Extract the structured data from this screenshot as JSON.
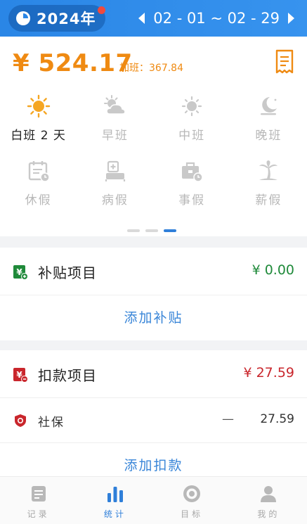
{
  "header": {
    "year": "2024年",
    "date_range": "02 - 01 ~ 02 - 29"
  },
  "summary": {
    "amount": "¥ 524.17",
    "overtime": "加班：367.84",
    "shifts": [
      {
        "label": "白班 2 天",
        "icon": "sun-icon",
        "active": true
      },
      {
        "label": "早班",
        "icon": "cloud-sun-icon",
        "active": false
      },
      {
        "label": "中班",
        "icon": "sun-small-icon",
        "active": false
      },
      {
        "label": "晚班",
        "icon": "moon-icon",
        "active": false
      },
      {
        "label": "休假",
        "icon": "calendar-icon",
        "active": false
      },
      {
        "label": "病假",
        "icon": "hospital-bed-icon",
        "active": false
      },
      {
        "label": "事假",
        "icon": "briefcase-icon",
        "active": false
      },
      {
        "label": "薪假",
        "icon": "palm-tree-icon",
        "active": false
      }
    ]
  },
  "subsidy": {
    "title": "补贴项目",
    "value": "¥ 0.00",
    "add_label": "添加补贴"
  },
  "deduction": {
    "title": "扣款项目",
    "value": "¥ 27.59",
    "items": [
      {
        "name": "社保",
        "dash": "—",
        "value": "27.59"
      }
    ],
    "add_label": "添加扣款"
  },
  "tabs": [
    {
      "label": "记录",
      "icon": "document-icon",
      "active": false
    },
    {
      "label": "统计",
      "icon": "bar-chart-icon",
      "active": true
    },
    {
      "label": "目标",
      "icon": "target-icon",
      "active": false
    },
    {
      "label": "我的",
      "icon": "user-icon",
      "active": false
    }
  ],
  "colors": {
    "brand_blue": "#2f7fd9",
    "amount_orange": "#ef8a12",
    "subsidy_green": "#1f8a3a",
    "deduction_red": "#c9262c"
  }
}
